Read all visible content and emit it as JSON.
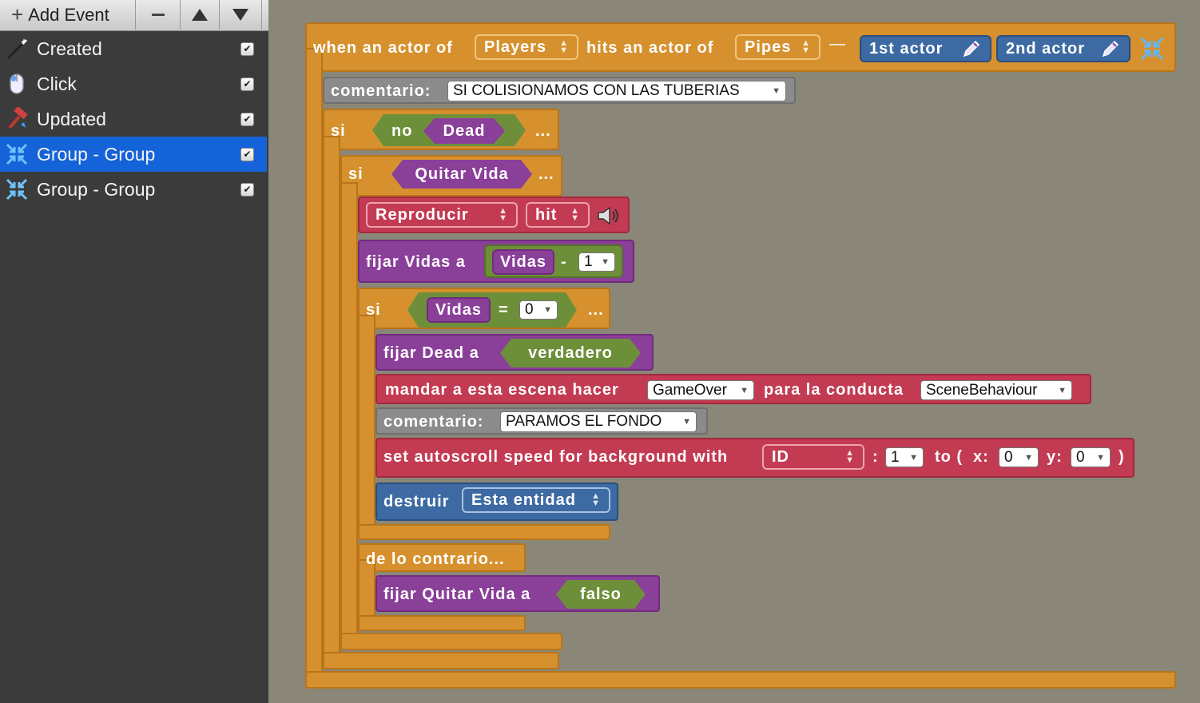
{
  "toolbar": {
    "add_event_label": "Add Event"
  },
  "events": [
    {
      "label": "Created",
      "icon": "wand-icon",
      "checked": true,
      "selected": false
    },
    {
      "label": "Click",
      "icon": "mouse-icon",
      "checked": true,
      "selected": false
    },
    {
      "label": "Updated",
      "icon": "hammer-icon",
      "checked": true,
      "selected": false
    },
    {
      "label": "Group - Group",
      "icon": "collision-icon",
      "checked": true,
      "selected": true
    },
    {
      "label": "Group - Group",
      "icon": "collision-icon",
      "checked": true,
      "selected": false
    }
  ],
  "checkmark": "✔",
  "blocks": {
    "header": {
      "when": "when an actor of",
      "group1": "Players",
      "hits": "hits an actor of",
      "group2": "Pipes",
      "dash": "—",
      "first_actor": "1st actor",
      "second_actor": "2nd actor"
    },
    "comment1": {
      "label": "comentario:",
      "value": "SI COLISIONAMOS CON LAS TUBERIAS"
    },
    "if1": {
      "si": "si",
      "no": "no",
      "var": "Dead",
      "dots": "..."
    },
    "if2": {
      "si": "si",
      "var": "Quitar Vida",
      "dots": "..."
    },
    "play": {
      "action": "Reproducir",
      "sound": "hit"
    },
    "set_vidas": {
      "label": "fijar Vidas a",
      "var": "Vidas",
      "op": "-",
      "value": "1"
    },
    "if3": {
      "si": "si",
      "var": "Vidas",
      "op": "=",
      "value": "0",
      "dots": "..."
    },
    "set_dead": {
      "label": "fijar Dead a",
      "value": "verdadero"
    },
    "send": {
      "label": "mandar a esta escena hacer",
      "msg": "GameOver",
      "para": "para la conducta",
      "behaviour": "SceneBehaviour"
    },
    "comment2": {
      "label": "comentario:",
      "value": "PARAMOS EL FONDO"
    },
    "autoscroll": {
      "label": "set autoscroll speed for background with",
      "id": "ID",
      "colon": ":",
      "id_value": "1",
      "to": "to (",
      "x_label": "x:",
      "x_value": "0",
      "y_label": "y:",
      "y_value": "0",
      "close": ")"
    },
    "destroy": {
      "label": "destruir",
      "target": "Esta entidad"
    },
    "else": {
      "label": "de lo contrario..."
    },
    "set_quitar": {
      "label": "fijar Quitar Vida a",
      "value": "falso"
    }
  },
  "colors": {
    "event_block": "#d6912e",
    "control": "#d6912e",
    "comment": "#8b8b8b",
    "variable": "#8a3f98",
    "sound_message": "#c33b52",
    "actor": "#3d6aa3",
    "boolean": "#6e8f3a",
    "sidebar_bg": "#3b3b3b",
    "selected": "#1463d8",
    "canvas_bg": "#8a8778"
  }
}
